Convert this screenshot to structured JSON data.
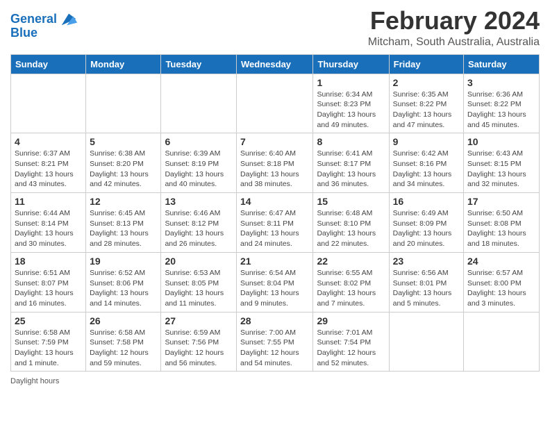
{
  "header": {
    "logo_line1": "General",
    "logo_line2": "Blue",
    "month": "February 2024",
    "location": "Mitcham, South Australia, Australia"
  },
  "days_of_week": [
    "Sunday",
    "Monday",
    "Tuesday",
    "Wednesday",
    "Thursday",
    "Friday",
    "Saturday"
  ],
  "weeks": [
    [
      {
        "day": "",
        "info": ""
      },
      {
        "day": "",
        "info": ""
      },
      {
        "day": "",
        "info": ""
      },
      {
        "day": "",
        "info": ""
      },
      {
        "day": "1",
        "info": "Sunrise: 6:34 AM\nSunset: 8:23 PM\nDaylight: 13 hours and 49 minutes."
      },
      {
        "day": "2",
        "info": "Sunrise: 6:35 AM\nSunset: 8:22 PM\nDaylight: 13 hours and 47 minutes."
      },
      {
        "day": "3",
        "info": "Sunrise: 6:36 AM\nSunset: 8:22 PM\nDaylight: 13 hours and 45 minutes."
      }
    ],
    [
      {
        "day": "4",
        "info": "Sunrise: 6:37 AM\nSunset: 8:21 PM\nDaylight: 13 hours and 43 minutes."
      },
      {
        "day": "5",
        "info": "Sunrise: 6:38 AM\nSunset: 8:20 PM\nDaylight: 13 hours and 42 minutes."
      },
      {
        "day": "6",
        "info": "Sunrise: 6:39 AM\nSunset: 8:19 PM\nDaylight: 13 hours and 40 minutes."
      },
      {
        "day": "7",
        "info": "Sunrise: 6:40 AM\nSunset: 8:18 PM\nDaylight: 13 hours and 38 minutes."
      },
      {
        "day": "8",
        "info": "Sunrise: 6:41 AM\nSunset: 8:17 PM\nDaylight: 13 hours and 36 minutes."
      },
      {
        "day": "9",
        "info": "Sunrise: 6:42 AM\nSunset: 8:16 PM\nDaylight: 13 hours and 34 minutes."
      },
      {
        "day": "10",
        "info": "Sunrise: 6:43 AM\nSunset: 8:15 PM\nDaylight: 13 hours and 32 minutes."
      }
    ],
    [
      {
        "day": "11",
        "info": "Sunrise: 6:44 AM\nSunset: 8:14 PM\nDaylight: 13 hours and 30 minutes."
      },
      {
        "day": "12",
        "info": "Sunrise: 6:45 AM\nSunset: 8:13 PM\nDaylight: 13 hours and 28 minutes."
      },
      {
        "day": "13",
        "info": "Sunrise: 6:46 AM\nSunset: 8:12 PM\nDaylight: 13 hours and 26 minutes."
      },
      {
        "day": "14",
        "info": "Sunrise: 6:47 AM\nSunset: 8:11 PM\nDaylight: 13 hours and 24 minutes."
      },
      {
        "day": "15",
        "info": "Sunrise: 6:48 AM\nSunset: 8:10 PM\nDaylight: 13 hours and 22 minutes."
      },
      {
        "day": "16",
        "info": "Sunrise: 6:49 AM\nSunset: 8:09 PM\nDaylight: 13 hours and 20 minutes."
      },
      {
        "day": "17",
        "info": "Sunrise: 6:50 AM\nSunset: 8:08 PM\nDaylight: 13 hours and 18 minutes."
      }
    ],
    [
      {
        "day": "18",
        "info": "Sunrise: 6:51 AM\nSunset: 8:07 PM\nDaylight: 13 hours and 16 minutes."
      },
      {
        "day": "19",
        "info": "Sunrise: 6:52 AM\nSunset: 8:06 PM\nDaylight: 13 hours and 14 minutes."
      },
      {
        "day": "20",
        "info": "Sunrise: 6:53 AM\nSunset: 8:05 PM\nDaylight: 13 hours and 11 minutes."
      },
      {
        "day": "21",
        "info": "Sunrise: 6:54 AM\nSunset: 8:04 PM\nDaylight: 13 hours and 9 minutes."
      },
      {
        "day": "22",
        "info": "Sunrise: 6:55 AM\nSunset: 8:02 PM\nDaylight: 13 hours and 7 minutes."
      },
      {
        "day": "23",
        "info": "Sunrise: 6:56 AM\nSunset: 8:01 PM\nDaylight: 13 hours and 5 minutes."
      },
      {
        "day": "24",
        "info": "Sunrise: 6:57 AM\nSunset: 8:00 PM\nDaylight: 13 hours and 3 minutes."
      }
    ],
    [
      {
        "day": "25",
        "info": "Sunrise: 6:58 AM\nSunset: 7:59 PM\nDaylight: 13 hours and 1 minute."
      },
      {
        "day": "26",
        "info": "Sunrise: 6:58 AM\nSunset: 7:58 PM\nDaylight: 12 hours and 59 minutes."
      },
      {
        "day": "27",
        "info": "Sunrise: 6:59 AM\nSunset: 7:56 PM\nDaylight: 12 hours and 56 minutes."
      },
      {
        "day": "28",
        "info": "Sunrise: 7:00 AM\nSunset: 7:55 PM\nDaylight: 12 hours and 54 minutes."
      },
      {
        "day": "29",
        "info": "Sunrise: 7:01 AM\nSunset: 7:54 PM\nDaylight: 12 hours and 52 minutes."
      },
      {
        "day": "",
        "info": ""
      },
      {
        "day": "",
        "info": ""
      }
    ]
  ],
  "footer": {
    "daylight_label": "Daylight hours"
  }
}
